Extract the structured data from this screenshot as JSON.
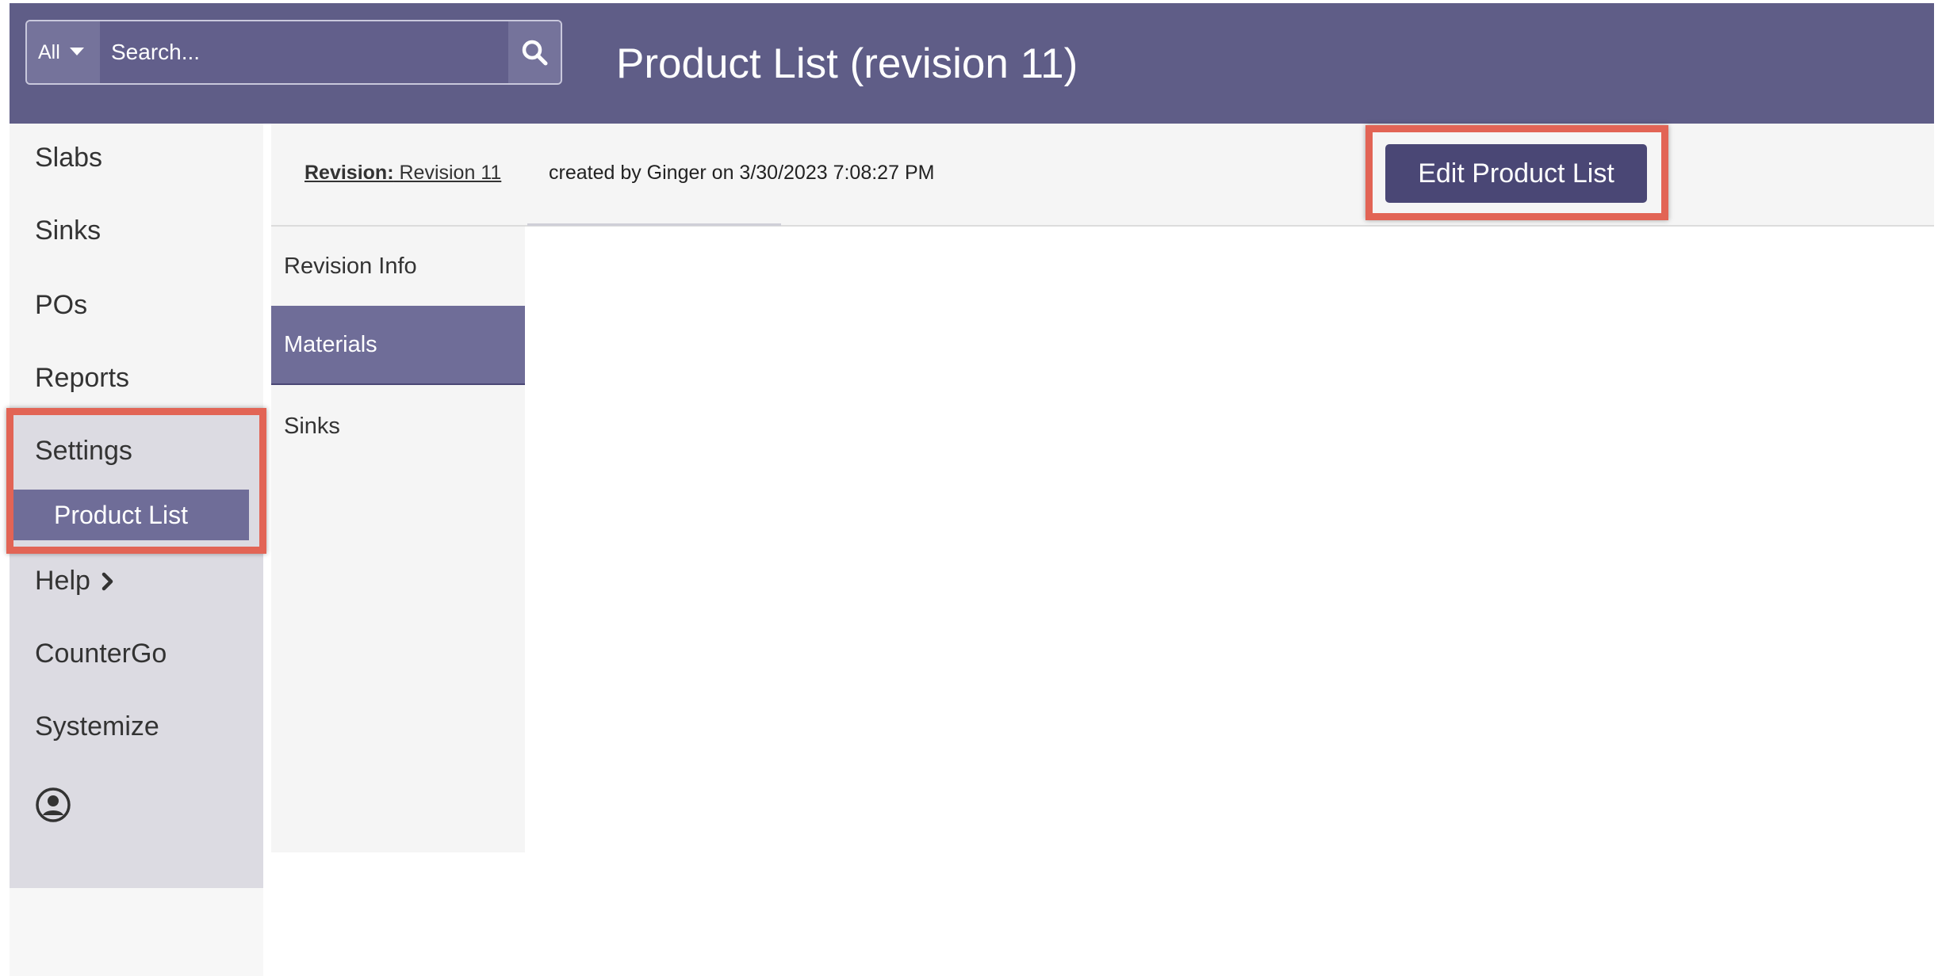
{
  "header": {
    "search": {
      "scope": "All",
      "placeholder": "Search...",
      "icon": "search-icon"
    },
    "title": "Product List (revision 11)"
  },
  "sidebar": {
    "items": [
      {
        "label": "Slabs"
      },
      {
        "label": "Sinks"
      },
      {
        "label": "POs"
      },
      {
        "label": "Reports"
      },
      {
        "label": "Settings"
      },
      {
        "label": "Help",
        "icon": "chevron-right-icon"
      },
      {
        "label": "CounterGo"
      },
      {
        "label": "Systemize"
      }
    ],
    "settings_subitems": [
      {
        "label": "Product List",
        "active": true
      }
    ],
    "user_icon": "user-circle-icon"
  },
  "revision": {
    "label": "Revision:",
    "name": "Revision 11",
    "meta": "created by Ginger on 3/30/2023 7:08:27 PM",
    "edit_button": "Edit Product List"
  },
  "tabs": [
    {
      "label": "Revision Info",
      "active": false
    },
    {
      "label": "Materials",
      "active": true
    },
    {
      "label": "Sinks",
      "active": false
    }
  ],
  "colors": {
    "header_bg": "#5f5d87",
    "accent": "#6f6d98",
    "button_bg": "#4a4775",
    "highlight": "#e26455"
  }
}
